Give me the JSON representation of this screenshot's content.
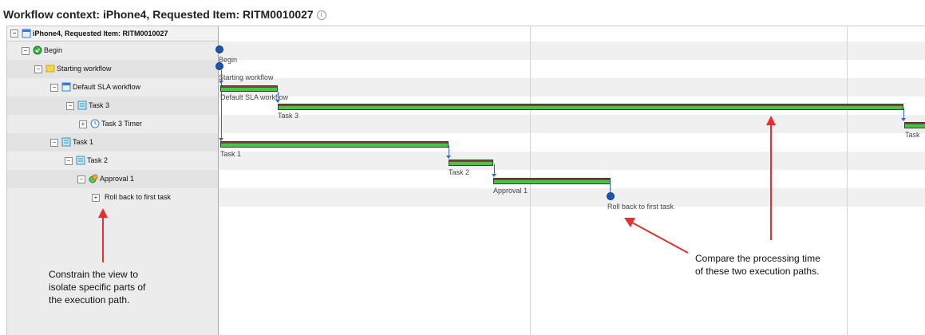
{
  "page": {
    "title": "Workflow context: iPhone4, Requested Item: RITM0010027",
    "info_glyph": "i"
  },
  "tree": {
    "root_label": "iPhone4, Requested Item: RITM0010027",
    "items": [
      {
        "label": "Begin",
        "icon": "begin-icon"
      },
      {
        "label": "Starting workflow",
        "icon": "workflow-folder-icon"
      },
      {
        "label": "Default SLA workflow",
        "icon": "subflow-icon"
      },
      {
        "label": "Task 3",
        "icon": "task-icon"
      },
      {
        "label": "Task 3 Timer",
        "icon": "timer-icon"
      },
      {
        "label": "Task 1",
        "icon": "task-icon"
      },
      {
        "label": "Task 2",
        "icon": "task-icon"
      },
      {
        "label": "Approval 1",
        "icon": "approval-icon"
      },
      {
        "label": "Roll back to first task",
        "icon": "none"
      }
    ],
    "toggle_glyphs": {
      "collapse": "−",
      "expand": "+"
    }
  },
  "timeline": {
    "labels": {
      "begin": "Begin",
      "starting": "Starting workflow",
      "default_sla": "Default SLA workflow",
      "task3": "Task 3",
      "task1": "Task 1",
      "task2": "Task 2",
      "approval1": "Approval 1",
      "rollback": "Roll back to first task",
      "task_edge": "Task"
    }
  },
  "annotations": {
    "left": [
      "Constrain the view to",
      "isolate specific parts of",
      "the execution path."
    ],
    "right": [
      "Compare the processing time",
      "of these two execution paths."
    ]
  },
  "colors": {
    "bar_fill": "#44c744",
    "bar_top": "#8a3c3c",
    "connector": "#3b64c9",
    "milestone": "#1c56b0",
    "arrow": "#e53030"
  }
}
